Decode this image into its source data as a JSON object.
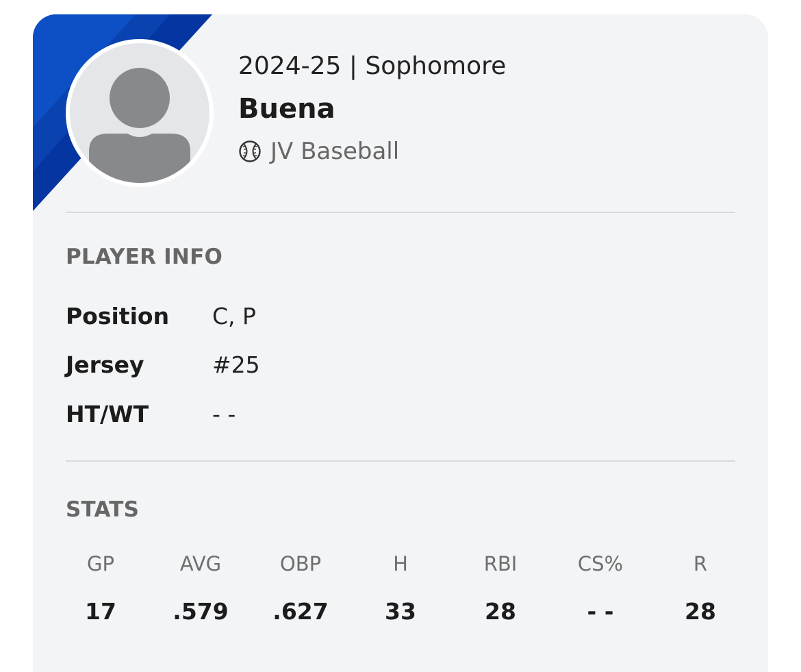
{
  "header": {
    "season_line": "2024-25 | Sophomore",
    "school_name": "Buena",
    "team_label": "JV Baseball",
    "team_icon": "baseball-icon",
    "avatar_icon": "person-placeholder-icon",
    "banner_color": "#0a3fa8"
  },
  "player_info": {
    "title": "PLAYER INFO",
    "rows": [
      {
        "label": "Position",
        "value": "C, P"
      },
      {
        "label": "Jersey",
        "value": "#25"
      },
      {
        "label": "HT/WT",
        "value": "- -"
      }
    ]
  },
  "stats": {
    "title": "STATS",
    "columns": [
      {
        "label": "GP",
        "value": "17"
      },
      {
        "label": "AVG",
        "value": ".579"
      },
      {
        "label": "OBP",
        "value": ".627"
      },
      {
        "label": "H",
        "value": "33"
      },
      {
        "label": "RBI",
        "value": "28"
      },
      {
        "label": "CS%",
        "value": "- -"
      },
      {
        "label": "R",
        "value": "28"
      }
    ]
  }
}
